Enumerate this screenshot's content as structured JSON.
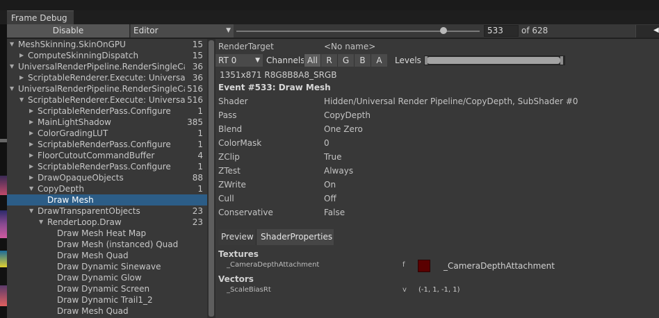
{
  "window": {
    "tab_title": "Frame Debug"
  },
  "toolbar": {
    "disable_label": "Disable",
    "target_dropdown": "Editor",
    "event_index": "533",
    "event_total": "of 628",
    "slider_fraction": 0.85
  },
  "tree": {
    "rows": [
      {
        "label": "MeshSkinning.SkinOnGPU",
        "count": "15",
        "depth": 0,
        "expanded": true,
        "has_children": true,
        "selected": false
      },
      {
        "label": "ComputeSkinningDispatch",
        "count": "15",
        "depth": 1,
        "expanded": false,
        "has_children": true,
        "selected": false
      },
      {
        "label": "UniversalRenderPipeline.RenderSingleCame",
        "count": "36",
        "depth": 0,
        "expanded": true,
        "has_children": true,
        "selected": false
      },
      {
        "label": "ScriptableRenderer.Execute: UniversalRer",
        "count": "36",
        "depth": 1,
        "expanded": false,
        "has_children": true,
        "selected": false
      },
      {
        "label": "UniversalRenderPipeline.RenderSingleCam",
        "count": "516",
        "depth": 0,
        "expanded": true,
        "has_children": true,
        "selected": false
      },
      {
        "label": "ScriptableRenderer.Execute: UniversalRe",
        "count": "516",
        "depth": 1,
        "expanded": true,
        "has_children": true,
        "selected": false
      },
      {
        "label": "ScriptableRenderPass.Configure",
        "count": "1",
        "depth": 2,
        "expanded": false,
        "has_children": true,
        "selected": false
      },
      {
        "label": "MainLightShadow",
        "count": "385",
        "depth": 2,
        "expanded": false,
        "has_children": true,
        "selected": false
      },
      {
        "label": "ColorGradingLUT",
        "count": "1",
        "depth": 2,
        "expanded": false,
        "has_children": true,
        "selected": false
      },
      {
        "label": "ScriptableRenderPass.Configure",
        "count": "1",
        "depth": 2,
        "expanded": false,
        "has_children": true,
        "selected": false
      },
      {
        "label": "FloorCutoutCommandBuffer",
        "count": "4",
        "depth": 2,
        "expanded": false,
        "has_children": true,
        "selected": false
      },
      {
        "label": "ScriptableRenderPass.Configure",
        "count": "1",
        "depth": 2,
        "expanded": false,
        "has_children": true,
        "selected": false
      },
      {
        "label": "DrawOpaqueObjects",
        "count": "88",
        "depth": 2,
        "expanded": false,
        "has_children": true,
        "selected": false
      },
      {
        "label": "CopyDepth",
        "count": "1",
        "depth": 2,
        "expanded": true,
        "has_children": true,
        "selected": false
      },
      {
        "label": "Draw Mesh",
        "count": "",
        "depth": 3,
        "expanded": false,
        "has_children": false,
        "selected": true
      },
      {
        "label": "DrawTransparentObjects",
        "count": "23",
        "depth": 2,
        "expanded": true,
        "has_children": true,
        "selected": false
      },
      {
        "label": "RenderLoop.Draw",
        "count": "23",
        "depth": 3,
        "expanded": true,
        "has_children": true,
        "selected": false
      },
      {
        "label": "Draw Mesh Heat Map",
        "count": "",
        "depth": 4,
        "expanded": false,
        "has_children": false,
        "selected": false
      },
      {
        "label": "Draw Mesh (instanced) Quad",
        "count": "",
        "depth": 4,
        "expanded": false,
        "has_children": false,
        "selected": false
      },
      {
        "label": "Draw Mesh Quad",
        "count": "",
        "depth": 4,
        "expanded": false,
        "has_children": false,
        "selected": false
      },
      {
        "label": "Draw Dynamic Sinewave",
        "count": "",
        "depth": 4,
        "expanded": false,
        "has_children": false,
        "selected": false
      },
      {
        "label": "Draw Dynamic Glow",
        "count": "",
        "depth": 4,
        "expanded": false,
        "has_children": false,
        "selected": false
      },
      {
        "label": "Draw Dynamic Screen",
        "count": "",
        "depth": 4,
        "expanded": false,
        "has_children": false,
        "selected": false
      },
      {
        "label": "Draw Dynamic Trail1_2",
        "count": "",
        "depth": 4,
        "expanded": false,
        "has_children": false,
        "selected": false
      },
      {
        "label": "Draw Mesh Quad",
        "count": "",
        "depth": 4,
        "expanded": false,
        "has_children": false,
        "selected": false
      }
    ]
  },
  "details": {
    "render_target_label": "RenderTarget",
    "render_target_value": "<No name>",
    "rt_select": "RT 0",
    "channels_label": "Channels",
    "channels": [
      "All",
      "R",
      "G",
      "B",
      "A"
    ],
    "levels_label": "Levels",
    "format": "1351x871 R8G8B8A8_SRGB",
    "event_title": "Event #533: Draw Mesh",
    "props": [
      {
        "key": "Shader",
        "value": "Hidden/Universal Render Pipeline/CopyDepth, SubShader #0"
      },
      {
        "key": "Pass",
        "value": "CopyDepth"
      },
      {
        "key": "Blend",
        "value": "One Zero"
      },
      {
        "key": "ColorMask",
        "value": "0"
      },
      {
        "key": "ZClip",
        "value": "True"
      },
      {
        "key": "ZTest",
        "value": "Always"
      },
      {
        "key": "ZWrite",
        "value": "On"
      },
      {
        "key": "Cull",
        "value": "Off"
      },
      {
        "key": "Conservative",
        "value": "False"
      }
    ],
    "subtabs": {
      "preview": "Preview",
      "shader_properties": "ShaderProperties"
    },
    "textures": {
      "header": "Textures",
      "name": "_CameraDepthAttachment",
      "flag": "f",
      "swatch_color": "#5a0000",
      "value": "_CameraDepthAttachment"
    },
    "vectors": {
      "header": "Vectors",
      "name": "_ScaleBiasRt",
      "flag": "v",
      "value": "(-1, 1, -1, 1)"
    }
  },
  "icons": {
    "expanded": "triangle-down-icon",
    "collapsed": "triangle-right-icon",
    "dropdown": "chevron-down-icon",
    "nav_prev": "arrow-left-icon"
  }
}
